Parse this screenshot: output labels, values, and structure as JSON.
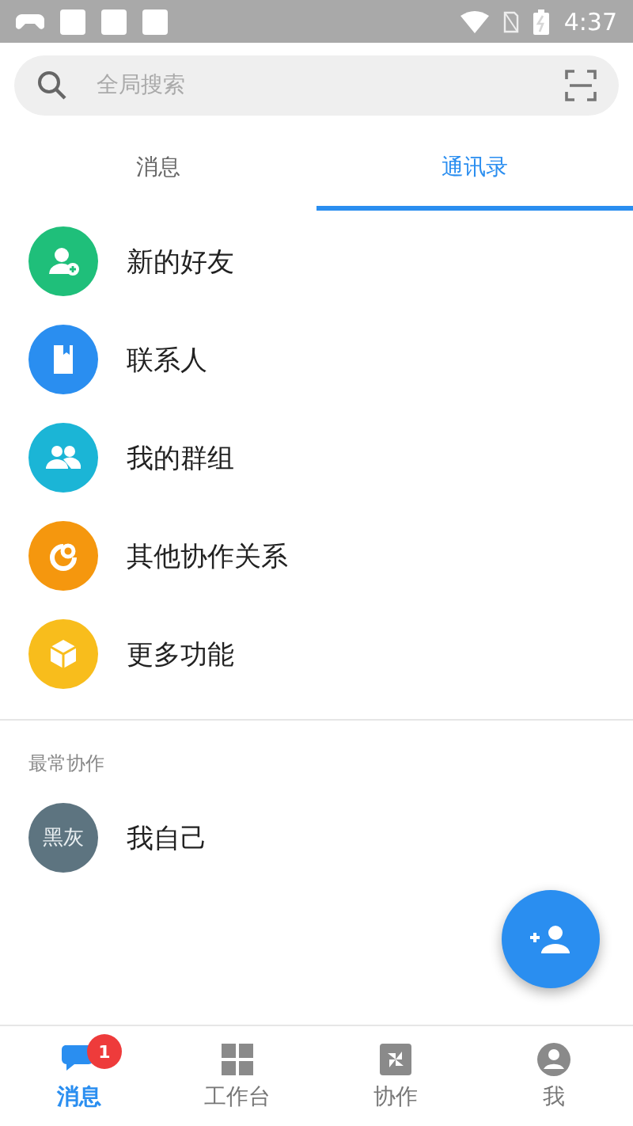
{
  "status_bar": {
    "time": "4:37"
  },
  "search": {
    "placeholder": "全局搜索"
  },
  "tabs": [
    {
      "label": "消息",
      "selected": false
    },
    {
      "label": "通讯录",
      "selected": true
    }
  ],
  "entries": [
    {
      "kind": "addfriend",
      "label": "新的好友",
      "color": "#1fbf7a"
    },
    {
      "kind": "contacts",
      "label": "联系人",
      "color": "#2a8ef0"
    },
    {
      "kind": "groups",
      "label": "我的群组",
      "color": "#1bb5d6"
    },
    {
      "kind": "relations",
      "label": "其他协作关系",
      "color": "#f5970e"
    },
    {
      "kind": "more",
      "label": "更多功能",
      "color": "#f8bd1c"
    }
  ],
  "frequent": {
    "title": "最常协作",
    "contacts": [
      {
        "avatar": "黑灰",
        "name": "我自己"
      }
    ]
  },
  "bottom_nav": [
    {
      "kind": "chat",
      "label": "消息",
      "selected": true,
      "badge": "1"
    },
    {
      "kind": "grid",
      "label": "工作台",
      "selected": false
    },
    {
      "kind": "pinwheel",
      "label": "协作",
      "selected": false
    },
    {
      "kind": "person",
      "label": "我",
      "selected": false
    }
  ]
}
